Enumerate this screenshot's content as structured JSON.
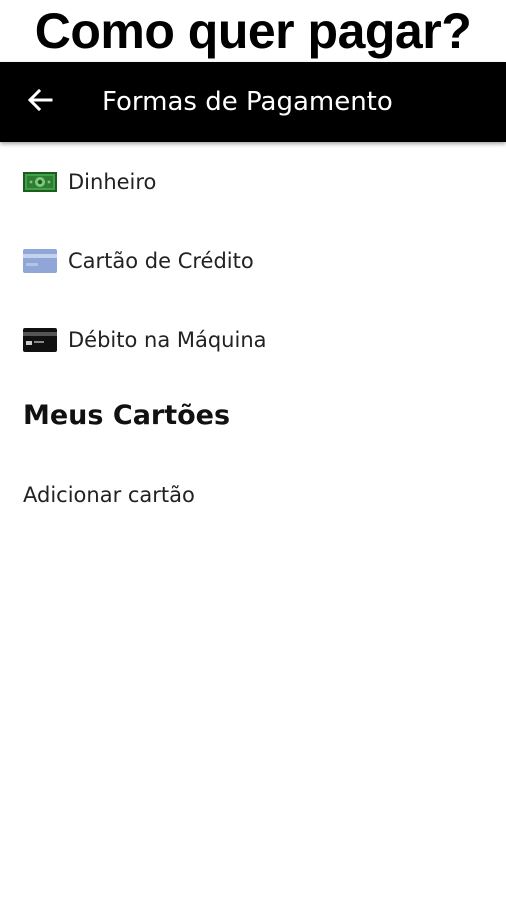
{
  "caption": "Como quer pagar?",
  "appbar": {
    "title": "Formas de Pagamento",
    "back_icon": "arrow-left-icon"
  },
  "payment_methods": [
    {
      "label": "Dinheiro",
      "icon": "cash-icon",
      "color": "#2e7d32"
    },
    {
      "label": "Cartão de Crédito",
      "icon": "credit-card-icon",
      "color": "#8fa6d6"
    },
    {
      "label": "Débito na Máquina",
      "icon": "debit-card-icon",
      "color": "#111111"
    }
  ],
  "cards_section": {
    "title": "Meus Cartões",
    "add_card_label": "Adicionar cartão"
  },
  "colors": {
    "appbar_bg": "#000000",
    "appbar_text": "#ffffff",
    "page_bg": "#ffffff"
  }
}
